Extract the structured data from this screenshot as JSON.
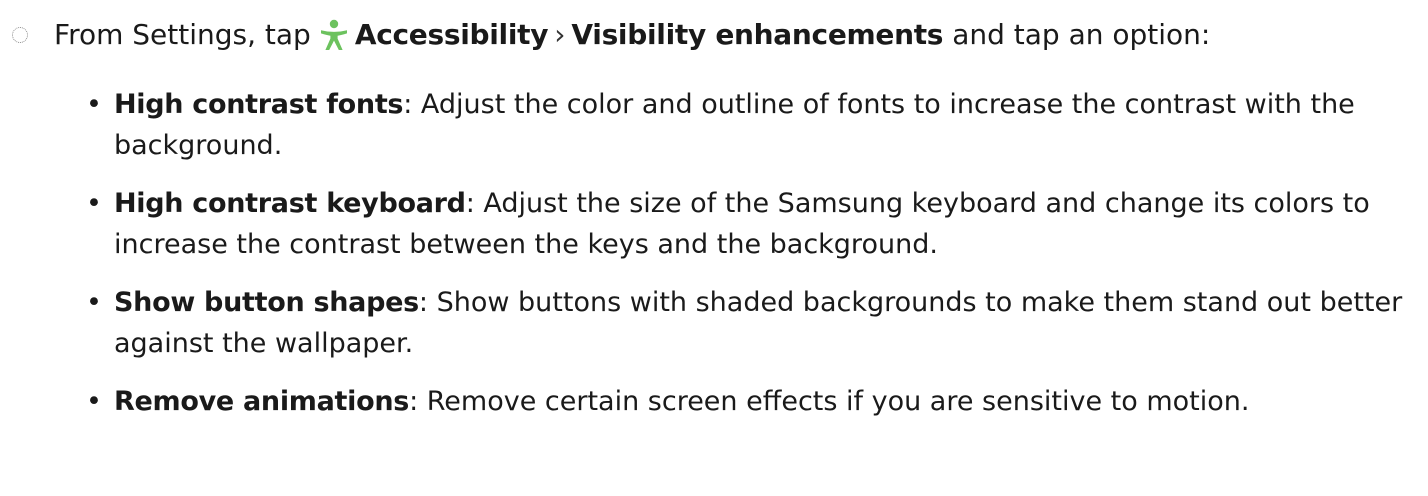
{
  "step": {
    "prefix": "From Settings, tap",
    "menu_accessibility": "Accessibility",
    "separator": "›",
    "menu_visibility": "Visibility enhancements",
    "suffix": "and tap an option:",
    "icon": "accessibility-icon",
    "icon_color": "#6cc25e"
  },
  "options": [
    {
      "name": "High contrast fonts",
      "description": ": Adjust the color and outline of fonts to increase the contrast with the background."
    },
    {
      "name": "High contrast keyboard",
      "description": ": Adjust the size of the Samsung keyboard and change its colors to increase the contrast between the keys and the background."
    },
    {
      "name": "Show button shapes",
      "description": ": Show buttons with shaded backgrounds to make them stand out better against the wallpaper."
    },
    {
      "name": "Remove animations",
      "description": ": Remove certain screen effects if you are sensitive to motion."
    }
  ]
}
